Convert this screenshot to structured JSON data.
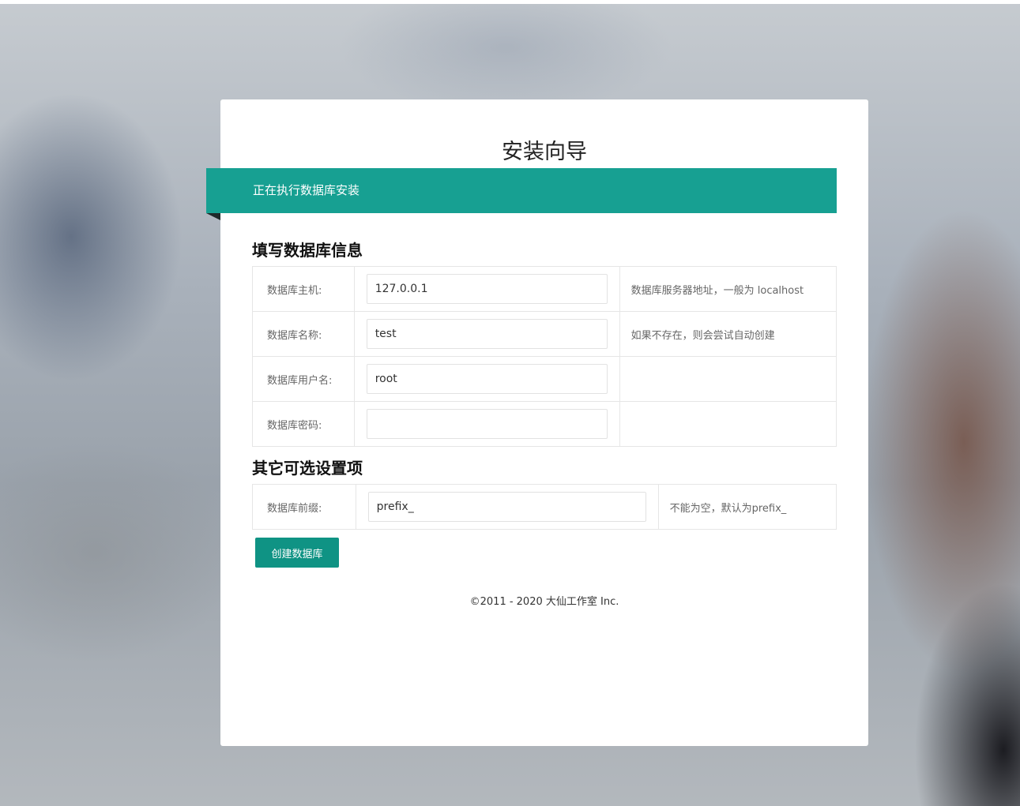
{
  "wizard": {
    "title": "安装向导",
    "step_banner": "正在执行数据库安装"
  },
  "db_section": {
    "heading": "填写数据库信息",
    "rows": [
      {
        "label": "数据库主机:",
        "value": "127.0.0.1",
        "tip": "数据库服务器地址，一般为 localhost"
      },
      {
        "label": "数据库名称:",
        "value": "test",
        "tip": "如果不存在，则会尝试自动创建"
      },
      {
        "label": "数据库用户名:",
        "value": "root",
        "tip": ""
      },
      {
        "label": "数据库密码:",
        "value": "",
        "tip": ""
      }
    ]
  },
  "optional_section": {
    "heading": "其它可选设置项",
    "rows": [
      {
        "label": "数据库前缀:",
        "value": "prefix_",
        "tip": "不能为空，默认为prefix_"
      }
    ]
  },
  "actions": {
    "submit_label": "创建数据库"
  },
  "footer": {
    "copyright": "©2011 - 2020 大仙工作室 Inc."
  },
  "theme": {
    "accent": "#17a092",
    "button": "#0f9384"
  }
}
